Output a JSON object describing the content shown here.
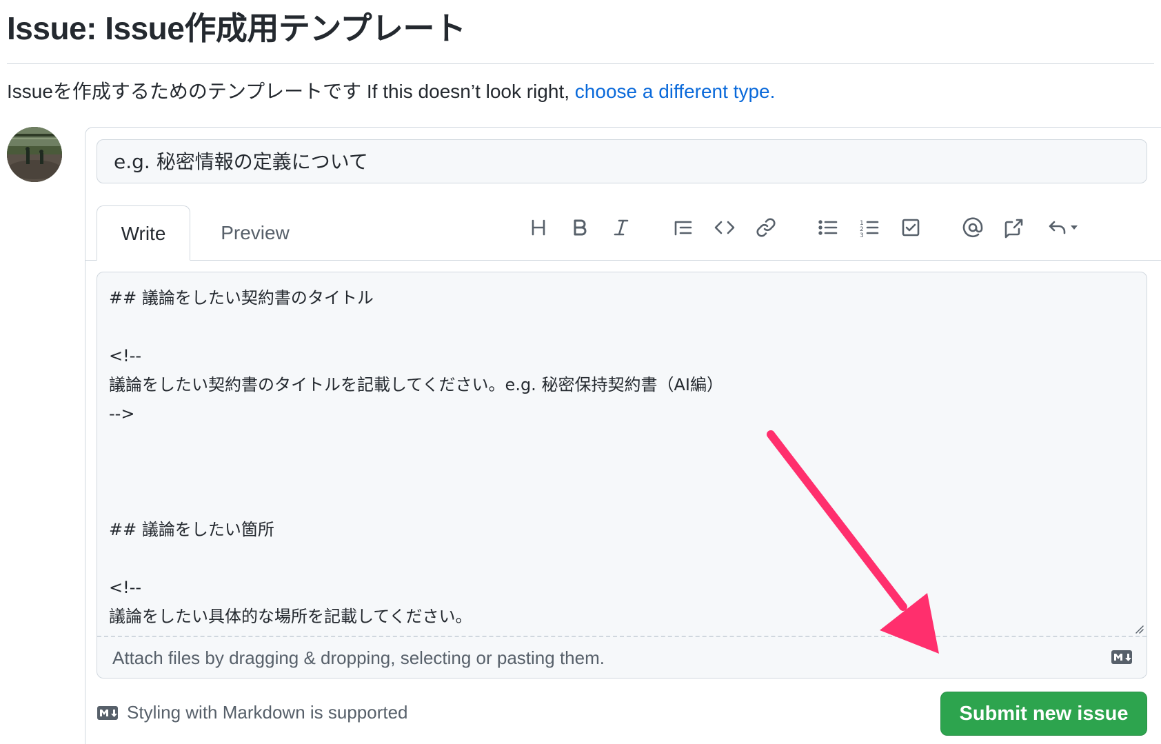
{
  "page": {
    "title": "Issue: Issue作成用テンプレート",
    "description": "Issueを作成するためのテンプレートです If this doesn’t look right, ",
    "change_link": "choose a different type."
  },
  "form": {
    "title_placeholder": "e.g. 秘密情報の定義について",
    "tabs": [
      {
        "label": "Write",
        "active": true
      },
      {
        "label": "Preview",
        "active": false
      }
    ],
    "toolbar_icons": [
      "heading-icon",
      "bold-icon",
      "italic-icon",
      "quote-icon",
      "code-icon",
      "link-icon",
      "bulleted-list-icon",
      "numbered-list-icon",
      "task-list-icon",
      "mention-icon",
      "cross-reference-icon",
      "reply-icon"
    ],
    "body_text": "## 議論をしたい契約書のタイトル\n\n<!--\n議論をしたい契約書のタイトルを記載してください。e.g. 秘密保持契約書（AI編）\n-->\n\n\n\n## 議論をしたい箇所\n\n<!--\n議論をしたい具体的な場所を記載してください。\n列の冒頭に>を挿入し、該当箇所引用表記にすると見やすいです。",
    "attach_text": "Attach files by dragging & dropping, selecting or pasting them.",
    "markdown_note": "Styling with Markdown is supported",
    "submit_label": "Submit new issue"
  },
  "colors": {
    "link": "#0969da",
    "submit_bg": "#2da44e",
    "arrow": "#ff2f6d"
  }
}
